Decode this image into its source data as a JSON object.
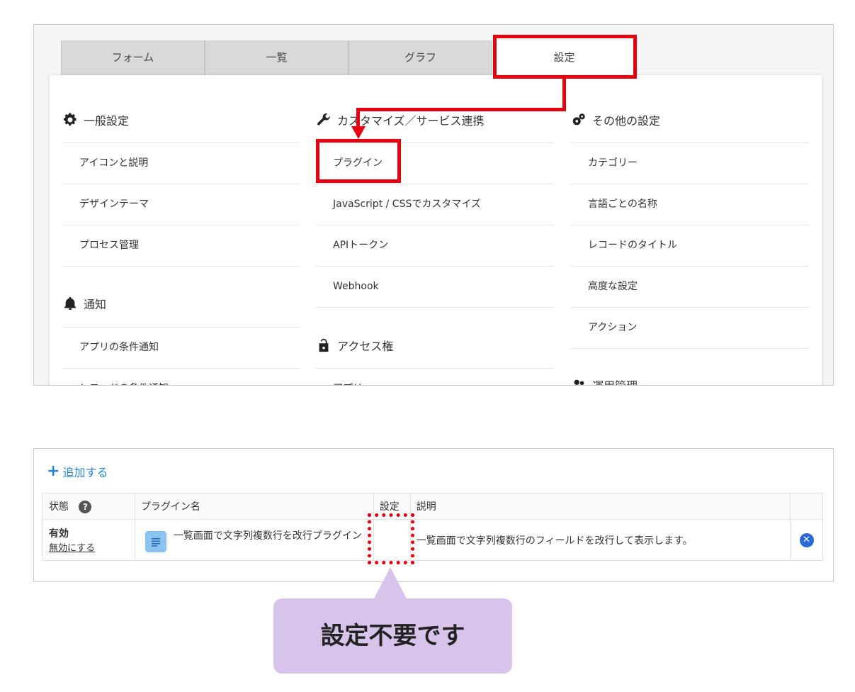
{
  "tabs": [
    "フォーム",
    "一覧",
    "グラフ",
    "設定"
  ],
  "menu": {
    "general": {
      "title": "一般設定",
      "items": [
        "アイコンと説明",
        "デザインテーマ",
        "プロセス管理"
      ]
    },
    "notify": {
      "title": "通知",
      "items": [
        "アプリの条件通知",
        "レコードの条件通知"
      ]
    },
    "custom": {
      "title": "カスタマイズ／サービス連携",
      "items": [
        "プラグイン",
        "JavaScript / CSSでカスタマイズ",
        "APIトークン",
        "Webhook"
      ]
    },
    "access": {
      "title": "アクセス権",
      "items": [
        "アプリ"
      ]
    },
    "other": {
      "title": "その他の設定",
      "items": [
        "カテゴリー",
        "言語ごとの名称",
        "レコードのタイトル",
        "高度な設定",
        "アクション"
      ]
    },
    "ops": {
      "title": "運用管理"
    }
  },
  "plugins": {
    "add_label": "追加する",
    "headers": {
      "status": "状態",
      "name": "プラグイン名",
      "settings": "設定",
      "description": "説明"
    },
    "row": {
      "status": "有効",
      "disable_label": "無効にする",
      "name": "一覧画面で文字列複数行を改行プラグイン",
      "description": "一覧画面で文字列複数行のフィールドを改行して表示します。"
    }
  },
  "callout": "設定不要です",
  "colors": {
    "annotation_red": "#e60012",
    "link_blue": "#2a83d2",
    "callout_bg": "#d8c4ea"
  }
}
